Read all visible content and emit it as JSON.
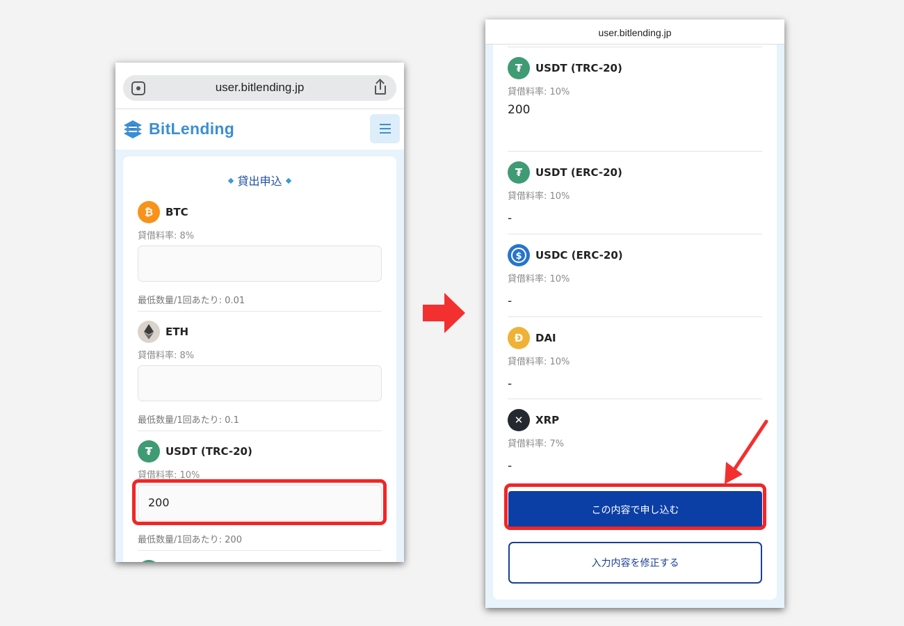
{
  "left_phone": {
    "url": "user.bitlending.jp",
    "brand": "BitLending",
    "heading": "貸出申込",
    "items": [
      {
        "symbol": "BTC",
        "rate": "貸借料率: 8%",
        "value": "",
        "minimum": "最低数量/1回あたり: 0.01",
        "icon_color": "#f7931a",
        "icon": "bitcoin-icon",
        "glyph": "₿"
      },
      {
        "symbol": "ETH",
        "rate": "貸借料率: 8%",
        "value": "",
        "minimum": "最低数量/1回あたり: 0.1",
        "icon_color": "#d9d3cc",
        "icon": "ethereum-icon",
        "glyph": ""
      },
      {
        "symbol": "USDT (TRC-20)",
        "rate": "貸借料率: 10%",
        "value": "200",
        "minimum": "最低数量/1回あたり: 200",
        "icon_color": "#3f9b74",
        "icon": "tether-icon",
        "glyph": "₮"
      }
    ]
  },
  "right_phone": {
    "url": "user.bitlending.jp",
    "items": [
      {
        "symbol": "USDT (TRC-20)",
        "rate": "貸借料率: 10%",
        "value": "200",
        "icon_color": "#3f9b74",
        "icon": "tether-icon",
        "glyph": "₮"
      },
      {
        "symbol": "USDT (ERC-20)",
        "rate": "貸借料率: 10%",
        "value": "-",
        "icon_color": "#3f9b74",
        "icon": "tether-icon",
        "glyph": "₮"
      },
      {
        "symbol": "USDC (ERC-20)",
        "rate": "貸借料率: 10%",
        "value": "-",
        "icon_color": "#2775ca",
        "icon": "usdc-icon",
        "glyph": "$"
      },
      {
        "symbol": "DAI",
        "rate": "貸借料率: 10%",
        "value": "-",
        "icon_color": "#f0b236",
        "icon": "dai-icon",
        "glyph": "Đ"
      },
      {
        "symbol": "XRP",
        "rate": "貸借料率: 7%",
        "value": "-",
        "icon_color": "#23292f",
        "icon": "xrp-icon",
        "glyph": "✕"
      }
    ],
    "submit_label": "この内容で申し込む",
    "edit_label": "入力内容を修正する"
  },
  "colors": {
    "accent_blue": "#0c3fa5",
    "highlight_red": "#f12626",
    "brand_blue": "#3a8fd3"
  }
}
